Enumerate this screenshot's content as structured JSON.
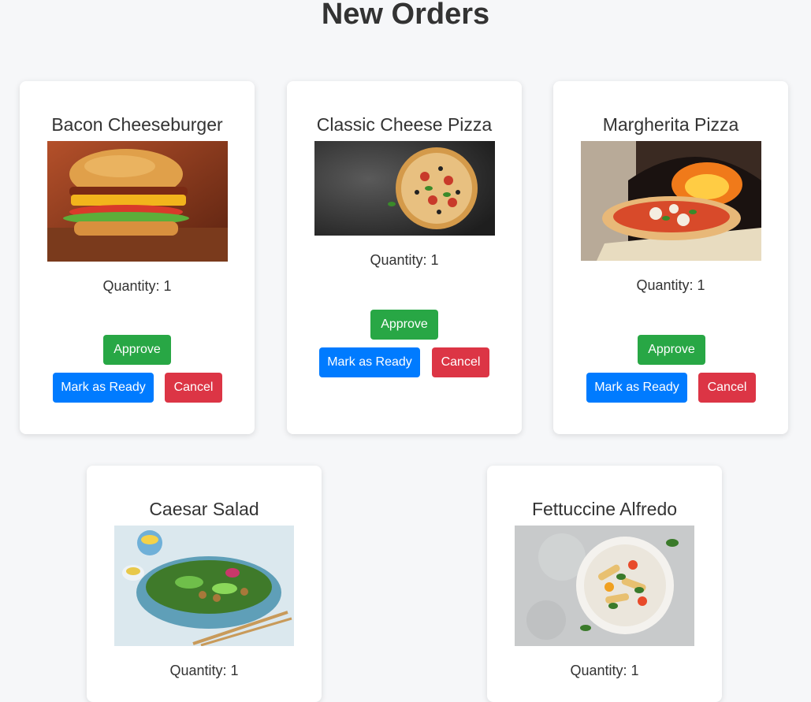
{
  "page": {
    "title": "New Orders"
  },
  "orders": [
    {
      "name": "Bacon Cheeseburger",
      "quantity": "Quantity: 1",
      "image_icon": "burger-image",
      "approve_label": "Approve",
      "ready_label": "Mark as Ready",
      "cancel_label": "Cancel"
    },
    {
      "name": "Classic Cheese Pizza",
      "quantity": "Quantity: 1",
      "image_icon": "pizza-image",
      "approve_label": "Approve",
      "ready_label": "Mark as Ready",
      "cancel_label": "Cancel"
    },
    {
      "name": "Margherita Pizza",
      "quantity": "Quantity: 1",
      "image_icon": "pizza-oven-image",
      "approve_label": "Approve",
      "ready_label": "Mark as Ready",
      "cancel_label": "Cancel"
    },
    {
      "name": "Caesar Salad",
      "quantity": "Quantity: 1",
      "image_icon": "salad-image"
    },
    {
      "name": "Fettuccine Alfredo",
      "quantity": "Quantity: 1",
      "image_icon": "pasta-image"
    }
  ],
  "colors": {
    "approve": "#28a745",
    "ready": "#007bff",
    "cancel": "#dc3545",
    "background": "#f6f7f9"
  }
}
